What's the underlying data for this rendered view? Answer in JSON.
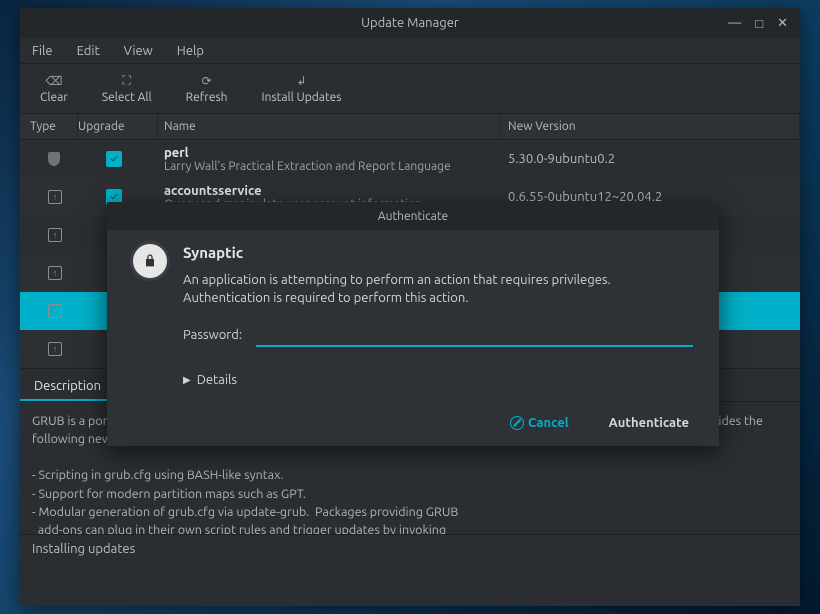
{
  "window": {
    "title": "Update Manager"
  },
  "menubar": [
    "File",
    "Edit",
    "View",
    "Help"
  ],
  "toolbar": {
    "clear": "Clear",
    "select_all": "Select All",
    "refresh": "Refresh",
    "install": "Install Updates"
  },
  "columns": {
    "type": "Type",
    "upgrade": "Upgrade",
    "name": "Name",
    "new_version": "New Version"
  },
  "packages": [
    {
      "type": "shield",
      "checked": true,
      "name": "perl",
      "desc": "Larry Wall's Practical Extraction and Report Language",
      "version": "5.30.0-9ubuntu0.2"
    },
    {
      "type": "up",
      "checked": true,
      "name": "accountsservice",
      "desc": "Query and manipulate user account information",
      "version": "0.6.55-0ubuntu12~20.04.2"
    },
    {
      "type": "up",
      "checked": false,
      "name": "",
      "desc": "",
      "version": ""
    },
    {
      "type": "up",
      "checked": false,
      "name": "",
      "desc": "",
      "version": ""
    },
    {
      "type": "up",
      "checked": false,
      "name": "",
      "desc": "",
      "version": "",
      "selected": true
    },
    {
      "type": "up",
      "checked": false,
      "name": "",
      "desc": "",
      "version": ""
    }
  ],
  "tabs": {
    "description": "Description"
  },
  "description_text": "GRUB is a portable, powerful bootloader.  This version of GRUB is based on a cleaner design than its predecessors, and provides the following new features:\n\n- Scripting in grub.cfg using BASH-like syntax.\n- Support for modern partition maps such as GPT.\n- Modular generation of grub.cfg via update-grub.  Packages providing GRUB\n  add-ons can plug in their own script rules and trigger updates by invoking\n  update-grub.",
  "status": "Installing updates",
  "dialog": {
    "title": "Authenticate",
    "app": "Synaptic",
    "message": "An application is attempting to perform an action that requires privileges. Authentication is required to perform this action.",
    "password_label": "Password:",
    "details": "Details",
    "cancel": "Cancel",
    "authenticate": "Authenticate"
  }
}
